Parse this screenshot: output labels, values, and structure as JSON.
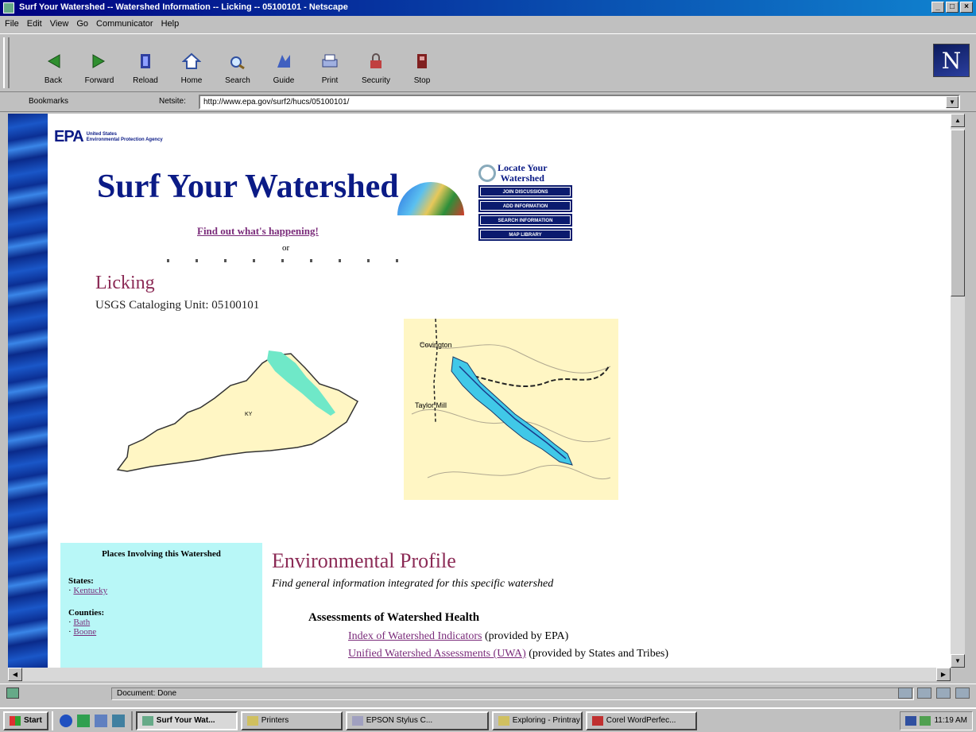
{
  "window": {
    "title": "Surf Your Watershed -- Watershed Information -- Licking -- 05100101 - Netscape",
    "controls": [
      "_",
      "□",
      "×"
    ]
  },
  "menu": [
    "File",
    "Edit",
    "View",
    "Go",
    "Communicator",
    "Help"
  ],
  "toolbar": {
    "buttons": [
      {
        "label": "Back",
        "icon": "back-arrow-icon"
      },
      {
        "label": "Forward",
        "icon": "forward-arrow-icon"
      },
      {
        "label": "Reload",
        "icon": "reload-icon"
      },
      {
        "label": "Home",
        "icon": "home-icon"
      },
      {
        "label": "Search",
        "icon": "search-icon"
      },
      {
        "label": "Guide",
        "icon": "guide-icon"
      },
      {
        "label": "Print",
        "icon": "print-icon"
      },
      {
        "label": "Security",
        "icon": "lock-icon"
      },
      {
        "label": "Stop",
        "icon": "stop-icon"
      }
    ],
    "logo": "N"
  },
  "location": {
    "bookmarks_label": "Bookmarks",
    "netsite_label": "Netsite:",
    "url": "http://www.epa.gov/surf2/hucs/05100101/"
  },
  "page": {
    "epa_mark": "EPA",
    "epa_agency_line1": "United States",
    "epa_agency_line2": "Environmental Protection Agency",
    "banner": "Surf Your Watershed",
    "find_out": "Find out what's happening!",
    "of": "or",
    "locate_title_line1": "Locate Your",
    "locate_title_line2": "Watershed",
    "locate_buttons": [
      "JOIN DISCUSSIONS",
      "ADD INFORMATION",
      "SEARCH INFORMATION",
      "MAP LIBRARY"
    ],
    "watershed_name": "Licking",
    "catalog_unit": "USGS Cataloging Unit: 05100101",
    "state_map_label": "KY",
    "city_labels": [
      "Covington",
      "Taylor Mill"
    ],
    "places": {
      "heading": "Places Involving this Watershed",
      "states_label": "States:",
      "states": [
        "Kentucky"
      ],
      "counties_label": "Counties:",
      "counties": [
        "Bath",
        "Boone"
      ]
    },
    "env_title": "Environmental Profile",
    "env_subtitle": "Find general information integrated for this specific watershed",
    "assess_title": "Assessments of Watershed Health",
    "assess_rows": [
      {
        "link": "Index of Watershed Indicators",
        "note": " (provided by EPA)"
      },
      {
        "link": "Unified Watershed Assessments (UWA)",
        "note": " (provided by States and Tribes)"
      }
    ]
  },
  "status": {
    "text": "Document: Done"
  },
  "taskbar": {
    "start": "Start",
    "tasks": [
      {
        "label": "Surf Your Wat...",
        "active": true
      },
      {
        "label": "Printers",
        "active": false
      },
      {
        "label": "EPSON Stylus C...",
        "active": false
      },
      {
        "label": "Exploring - Printray",
        "active": false
      },
      {
        "label": "Corel WordPerfec...",
        "active": false
      }
    ],
    "clock": "11:19 AM"
  }
}
